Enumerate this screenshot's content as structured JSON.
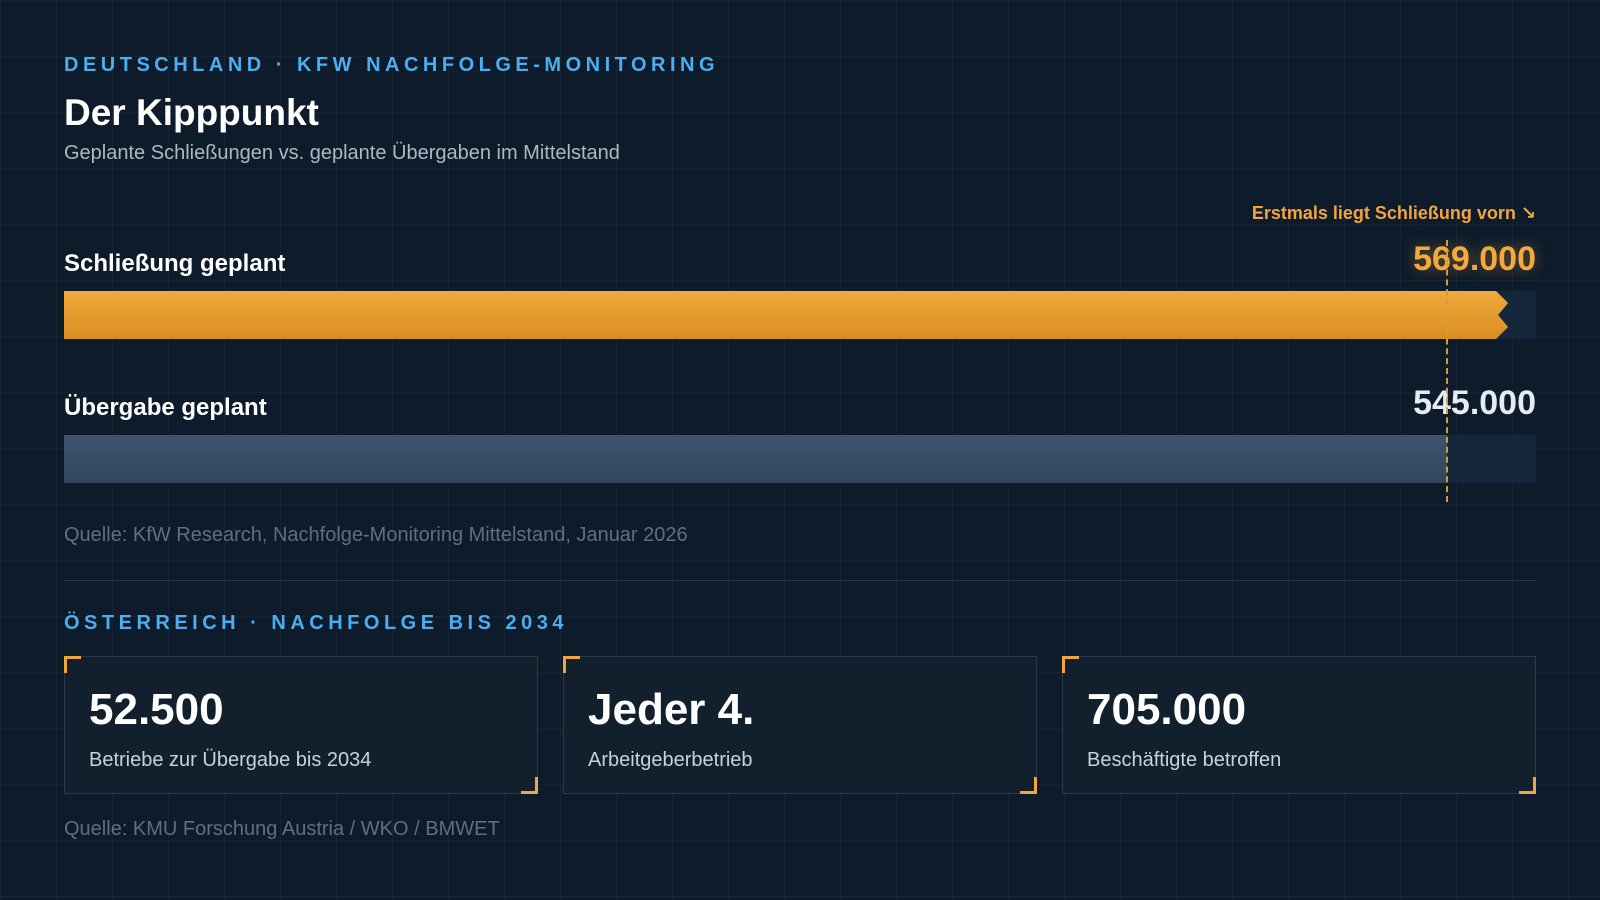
{
  "header": {
    "eyebrow": "DEUTSCHLAND · KFW NACHFOLGE-MONITORING",
    "title": "Der Kipppunkt",
    "subtitle": "Geplante Schließungen vs. geplante Übergaben im Mittelstand"
  },
  "chart_data": {
    "type": "bar",
    "orientation": "horizontal",
    "title": "Der Kipppunkt",
    "subtitle": "Geplante Schließungen vs. geplante Übergaben im Mittelstand",
    "categories": [
      "Schließung geplant",
      "Übergabe geplant"
    ],
    "values": [
      569000,
      545000
    ],
    "value_labels": [
      "569.000",
      "545.000"
    ],
    "xlim": [
      0,
      580000
    ],
    "reference_line": {
      "value": 545000
    },
    "annotation": "Erstmals liegt Schließung vorn ↘",
    "colors": {
      "closure": "#f0a93b",
      "transfer": "#3f556e",
      "accent": "#4aaef0"
    },
    "grid": false,
    "legend": "none",
    "source": "Quelle: KfW Research, Nachfolge-Monitoring Mittelstand, Januar 2026"
  },
  "austria": {
    "eyebrow": "ÖSTERREICH · NACHFOLGE BIS 2034",
    "cards": [
      {
        "value": "52.500",
        "label": "Betriebe zur Übergabe bis 2034"
      },
      {
        "value": "Jeder 4.",
        "label": "Arbeitgeberbetrieb"
      },
      {
        "value": "705.000",
        "label": "Beschäftigte betroffen"
      }
    ],
    "source": "Quelle: KMU Forschung Austria / WKO / BMWET"
  }
}
